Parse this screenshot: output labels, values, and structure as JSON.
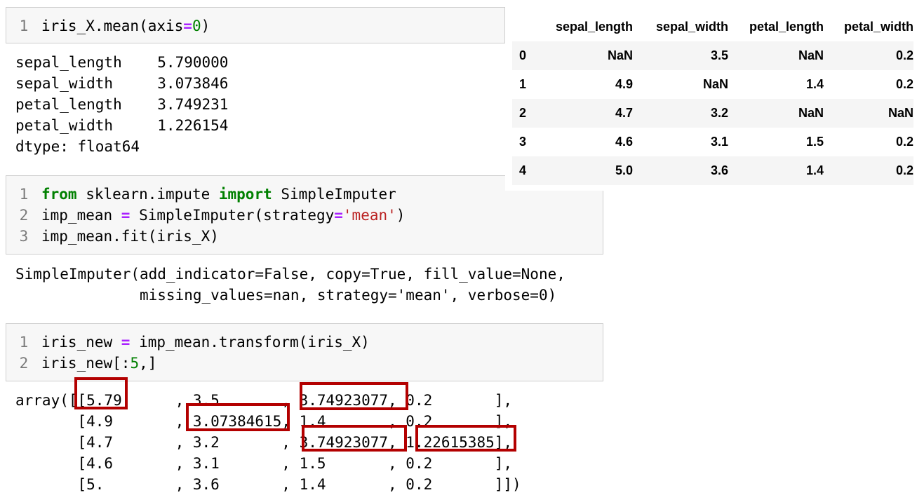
{
  "cell1": {
    "lines": [
      {
        "n": "1",
        "tokens": [
          [
            "",
            "iris_X.mean(axis"
          ],
          [
            "op",
            "="
          ],
          [
            "num",
            "0"
          ],
          [
            "",
            ")"
          ]
        ]
      }
    ]
  },
  "out1": [
    "sepal_length    5.790000",
    "sepal_width     3.073846",
    "petal_length    3.749231",
    "petal_width     1.226154",
    "dtype: float64"
  ],
  "cell2": {
    "lines": [
      {
        "n": "1",
        "tokens": [
          [
            "kw",
            "from"
          ],
          [
            "",
            " sklearn.impute "
          ],
          [
            "kw",
            "import"
          ],
          [
            "",
            " SimpleImputer"
          ]
        ]
      },
      {
        "n": "2",
        "tokens": [
          [
            "",
            "imp_mean "
          ],
          [
            "op",
            "="
          ],
          [
            "",
            " SimpleImputer(strategy"
          ],
          [
            "op",
            "="
          ],
          [
            "str",
            "'mean'"
          ],
          [
            "",
            ")"
          ]
        ]
      },
      {
        "n": "3",
        "tokens": [
          [
            "",
            "imp_mean.fit(iris_X)"
          ]
        ]
      }
    ]
  },
  "out2": [
    "SimpleImputer(add_indicator=False, copy=True, fill_value=None,",
    "              missing_values=nan, strategy='mean', verbose=0)"
  ],
  "cell3": {
    "lines": [
      {
        "n": "1",
        "tokens": [
          [
            "",
            "iris_new "
          ],
          [
            "op",
            "="
          ],
          [
            "",
            " imp_mean.transform(iris_X)"
          ]
        ]
      },
      {
        "n": "2",
        "tokens": [
          [
            "",
            "iris_new[:"
          ],
          [
            "num",
            "5"
          ],
          [
            "",
            ",]"
          ]
        ]
      }
    ]
  },
  "out3": [
    "array([[5.79      , 3.5       , 3.74923077, 0.2       ],",
    "       [4.9       , 3.07384615, 1.4       , 0.2       ],",
    "       [4.7       , 3.2       , 3.74923077, 1.22615385],",
    "       [4.6       , 3.1       , 1.5       , 0.2       ],",
    "       [5.        , 3.6       , 1.4       , 0.2       ]])"
  ],
  "dataframe": {
    "columns": [
      "",
      "sepal_length",
      "sepal_width",
      "petal_length",
      "petal_width"
    ],
    "rows": [
      [
        "0",
        "NaN",
        "3.5",
        "NaN",
        "0.2"
      ],
      [
        "1",
        "4.9",
        "NaN",
        "1.4",
        "0.2"
      ],
      [
        "2",
        "4.7",
        "3.2",
        "NaN",
        "NaN"
      ],
      [
        "3",
        "4.6",
        "3.1",
        "1.5",
        "0.2"
      ],
      [
        "4",
        "5.0",
        "3.6",
        "1.4",
        "0.2"
      ]
    ]
  },
  "highlight_color": "#b30000"
}
